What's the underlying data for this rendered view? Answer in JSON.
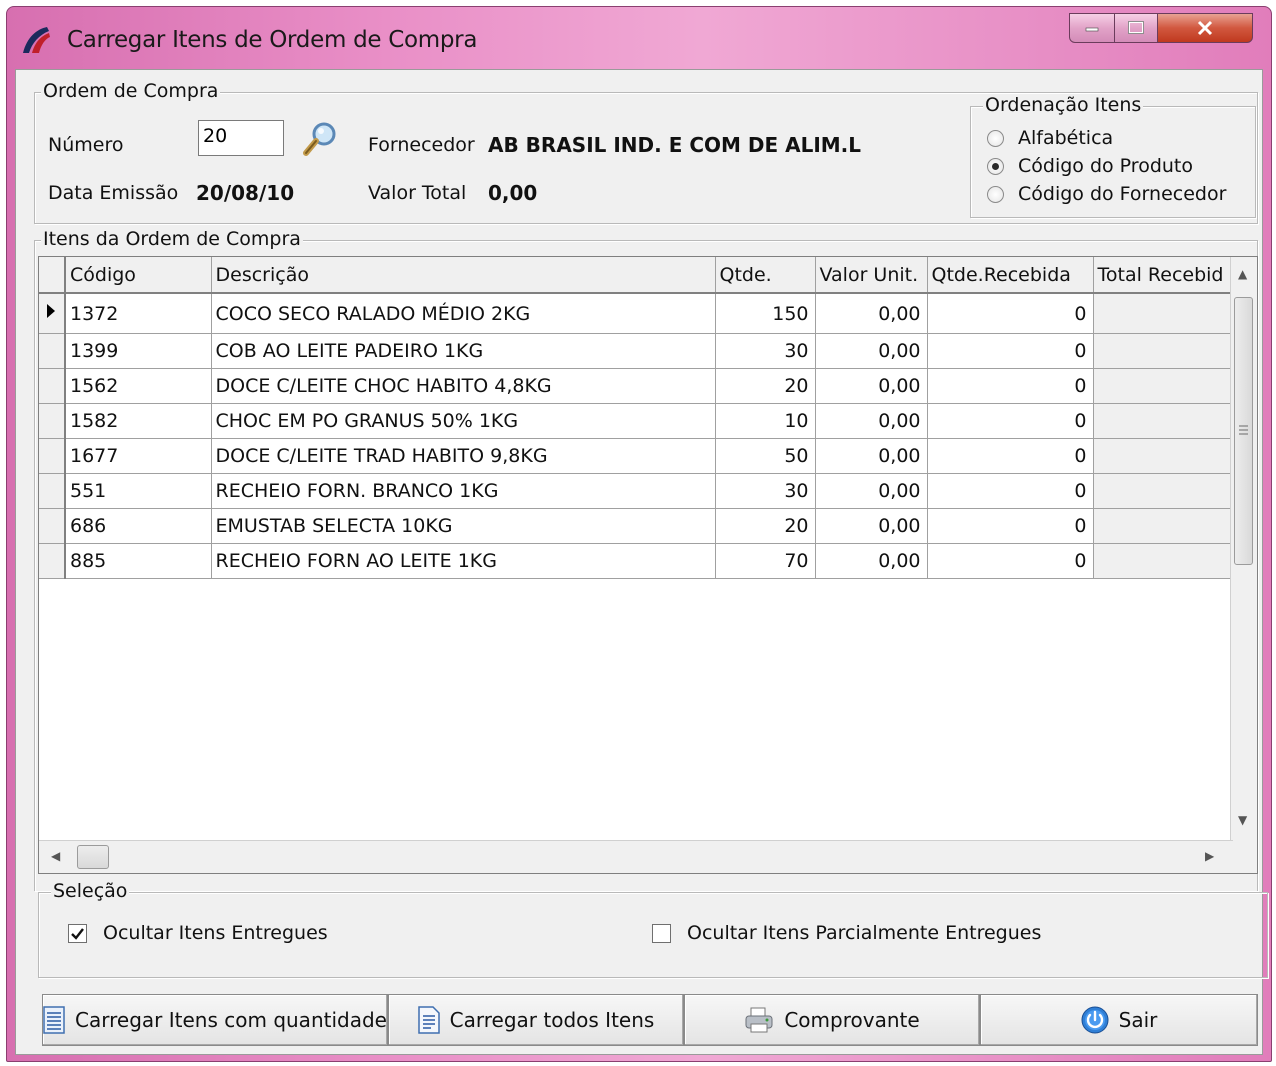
{
  "window": {
    "title": "Carregar Itens de Ordem de Compra"
  },
  "ordem": {
    "legend": "Ordem de Compra",
    "numero_label": "Número",
    "numero_value": "20",
    "fornecedor_label": "Fornecedor",
    "fornecedor_value": "AB BRASIL IND. E COM DE ALIM.L",
    "data_label": "Data Emissão",
    "data_value": "20/08/10",
    "valor_label": "Valor Total",
    "valor_value": "0,00"
  },
  "ordenacao": {
    "legend": "Ordenação Itens",
    "options": [
      "Alfabética",
      "Código do Produto",
      "Código do Fornecedor"
    ],
    "selected": 1
  },
  "itens": {
    "legend": "Itens da Ordem de Compra",
    "columns": [
      "Código",
      "Descrição",
      "Qtde.",
      "Valor Unit.",
      "Qtde.Recebida",
      "Total Recebid"
    ],
    "rows": [
      [
        "1372",
        "COCO SECO RALADO MÉDIO 2KG",
        "150",
        "0,00",
        "0",
        ""
      ],
      [
        "1399",
        "COB AO LEITE PADEIRO 1KG",
        "30",
        "0,00",
        "0",
        ""
      ],
      [
        "1562",
        "DOCE C/LEITE CHOC HABITO 4,8KG",
        "20",
        "0,00",
        "0",
        ""
      ],
      [
        "1582",
        "CHOC EM PO GRANUS 50% 1KG",
        "10",
        "0,00",
        "0",
        ""
      ],
      [
        "1677",
        "DOCE C/LEITE TRAD HABITO 9,8KG",
        "50",
        "0,00",
        "0",
        ""
      ],
      [
        "551",
        "RECHEIO FORN. BRANCO 1KG",
        "30",
        "0,00",
        "0",
        ""
      ],
      [
        "686",
        "EMUSTAB SELECTA 10KG",
        "20",
        "0,00",
        "0",
        ""
      ],
      [
        "885",
        "RECHEIO FORN AO LEITE 1KG",
        "70",
        "0,00",
        "0",
        ""
      ]
    ]
  },
  "selecao": {
    "legend": "Seleção",
    "ocultar_entregues": "Ocultar Itens Entregues",
    "ocultar_entregues_checked": true,
    "ocultar_parcial": "Ocultar Itens Parcialmente Entregues",
    "ocultar_parcial_checked": false
  },
  "buttons": {
    "carregar_qtd": "Carregar Itens com quantidade",
    "carregar_todos": "Carregar todos Itens",
    "comprovante": "Comprovante",
    "sair": "Sair"
  }
}
